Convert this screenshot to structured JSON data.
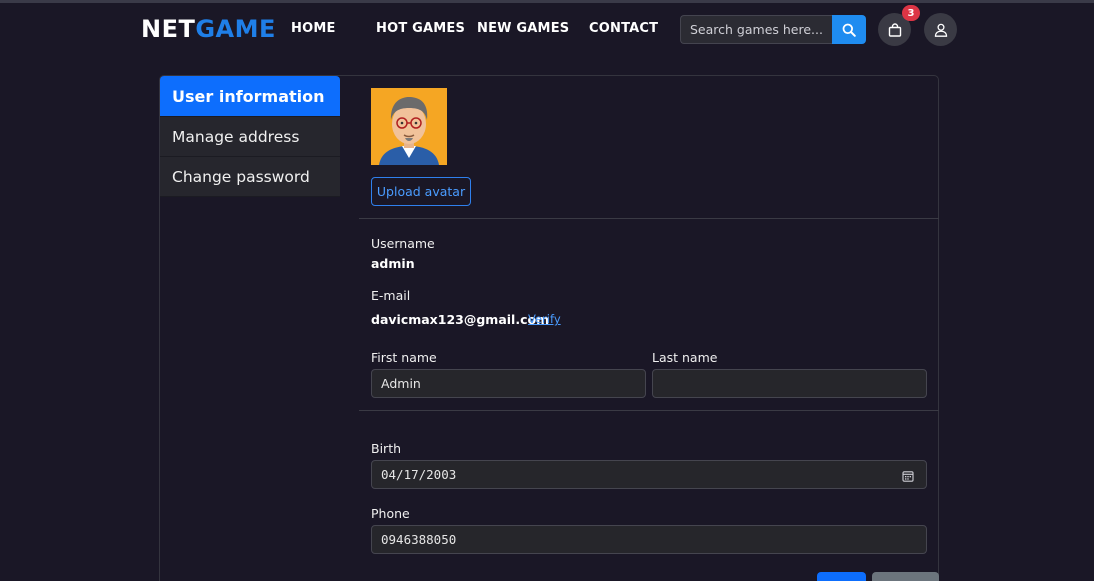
{
  "brand": {
    "part1": "NET",
    "part2": "GAME"
  },
  "nav": {
    "home": "HOME",
    "hot_games": "HOT GAMES",
    "new_games": "NEW GAMES",
    "contact": "CONTACT"
  },
  "search": {
    "placeholder": "Search games here...",
    "value": ""
  },
  "cart": {
    "count": "3"
  },
  "sidebar": {
    "items": [
      {
        "label": "User information",
        "active": true
      },
      {
        "label": "Manage address",
        "active": false
      },
      {
        "label": "Change password",
        "active": false
      }
    ]
  },
  "profile": {
    "upload_label": "Upload avatar",
    "username_label": "Username",
    "username": "admin",
    "email_label": "E-mail",
    "email": "davicmax123@gmail.com",
    "verify_label": "Verify",
    "first_name_label": "First name",
    "first_name": "Admin",
    "last_name_label": "Last name",
    "last_name": "",
    "birth_label": "Birth",
    "birth": "04/17/2003",
    "phone_label": "Phone",
    "phone": "0946388050"
  },
  "colors": {
    "accent": "#0d6efd",
    "background": "#1a1726",
    "badge": "#dc3545",
    "avatar_bg": "#f5a623"
  }
}
